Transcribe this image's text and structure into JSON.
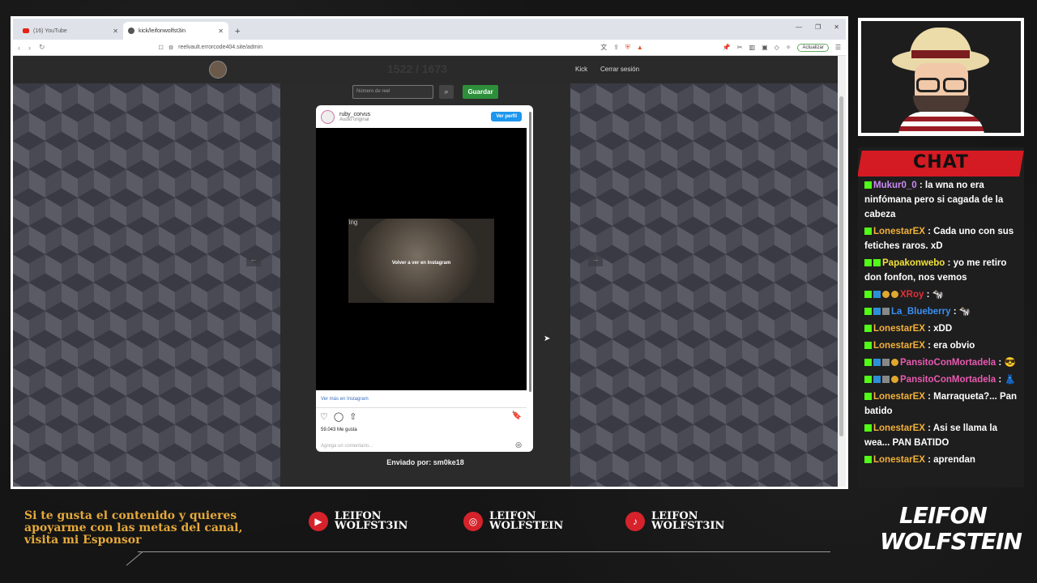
{
  "browser": {
    "tabs": [
      {
        "label": "(16) YouTube"
      },
      {
        "label": "kick/leifonwolfst3in"
      }
    ],
    "url": "reelvault.errorcode404.site/admin",
    "update_label": "Actualizar"
  },
  "site": {
    "counter": "1522 / 1673",
    "nav": {
      "kick": "Kick",
      "logout": "Cerrar sesión"
    },
    "reel_placeholder": "Número de reel",
    "save_label": "Guardar",
    "sent_by": "Enviado por: sm0ke18",
    "prev_arrow": "←",
    "next_arrow": "→"
  },
  "instagram": {
    "username": "ruby_corvus",
    "audio": "Audio original",
    "profile_button": "Ver perfil",
    "thumb_text": "ring",
    "rewatch": "Volver a ver en Instagram",
    "more": "Ver más en Instagram",
    "likes": "59.043 Me gusta",
    "comment_placeholder": "Agrega un comentario..."
  },
  "chat": {
    "title": "CHAT",
    "messages": [
      {
        "user": "Mukur0_0",
        "color": "#c98bf2",
        "text": "la wna no era ninfómana pero si cagada de la cabeza",
        "badges": [
          "kick"
        ]
      },
      {
        "user": "LonestarEX",
        "color": "#f2b13a",
        "text": "Cada uno con sus fetiches raros. xD",
        "badges": [
          "kick"
        ]
      },
      {
        "user": "Papakonwebo",
        "color": "#f2e13a",
        "text": "yo me retiro don fonfon, nos vemos",
        "badges": [
          "kick",
          "kick"
        ]
      },
      {
        "user": "XRoy",
        "color": "#e0303a",
        "text": "🐄",
        "badges": [
          "kick",
          "blue",
          "gold",
          "gold"
        ]
      },
      {
        "user": "La_Blueberry",
        "color": "#3a8ff2",
        "text": "🐄",
        "badges": [
          "kick",
          "blue",
          "gray"
        ]
      },
      {
        "user": "LonestarEX",
        "color": "#f2b13a",
        "text": "xDD",
        "badges": [
          "kick"
        ]
      },
      {
        "user": "LonestarEX",
        "color": "#f2b13a",
        "text": "era obvio",
        "badges": [
          "kick"
        ]
      },
      {
        "user": "PansitoConMortadela",
        "color": "#e85ab0",
        "text": "😎",
        "badges": [
          "kick",
          "blue",
          "gray",
          "gold"
        ]
      },
      {
        "user": "PansitoConMortadela",
        "color": "#e85ab0",
        "text": "👗",
        "badges": [
          "kick",
          "blue",
          "gray",
          "gold"
        ]
      },
      {
        "user": "LonestarEX",
        "color": "#f2b13a",
        "text": "Marraqueta?... Pan batido",
        "badges": [
          "kick"
        ]
      },
      {
        "user": "LonestarEX",
        "color": "#f2b13a",
        "text": "Asi se llama la wea... PAN BATIDO",
        "badges": [
          "kick"
        ]
      },
      {
        "user": "LonestarEX",
        "color": "#f2b13a",
        "text": "aprendan",
        "badges": [
          "kick"
        ]
      }
    ]
  },
  "footer": {
    "line1": "Si te gusta el contenido y quieres",
    "line2": "apoyarme con las metas del canal,",
    "line3": "visita mi Esponsor",
    "socials": [
      {
        "icon": "youtube-icon",
        "line1": "LEIFON",
        "line2": "WOLFST3IN"
      },
      {
        "icon": "instagram-icon",
        "line1": "LEIFON",
        "line2": "WOLFSTEIN"
      },
      {
        "icon": "tiktok-icon",
        "line1": "LEIFON",
        "line2": "WOLFST3IN"
      }
    ],
    "logo_line1": "LEIFON",
    "logo_line2": "WOLFSTEIN"
  }
}
